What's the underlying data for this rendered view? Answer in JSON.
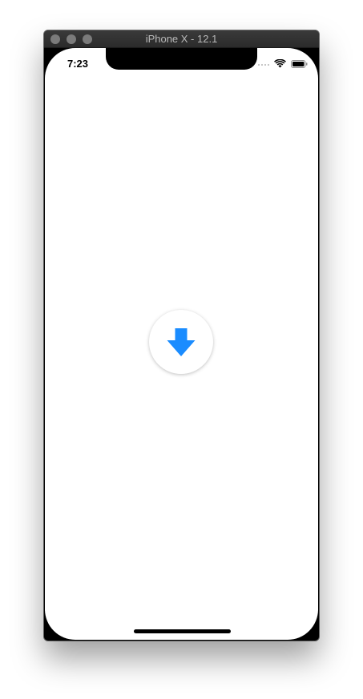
{
  "window": {
    "title": "iPhone X - 12.1"
  },
  "status_bar": {
    "time": "7:23",
    "wifi_icon": "wifi-icon",
    "battery_icon": "battery-icon",
    "signal_icon": "signal-dots-icon"
  },
  "main": {
    "download_button_icon": "arrow-down-icon"
  },
  "colors": {
    "accent": "#1A8CFF",
    "titlebar": "#2F2F2F",
    "screen_background": "#FFFFFF"
  }
}
